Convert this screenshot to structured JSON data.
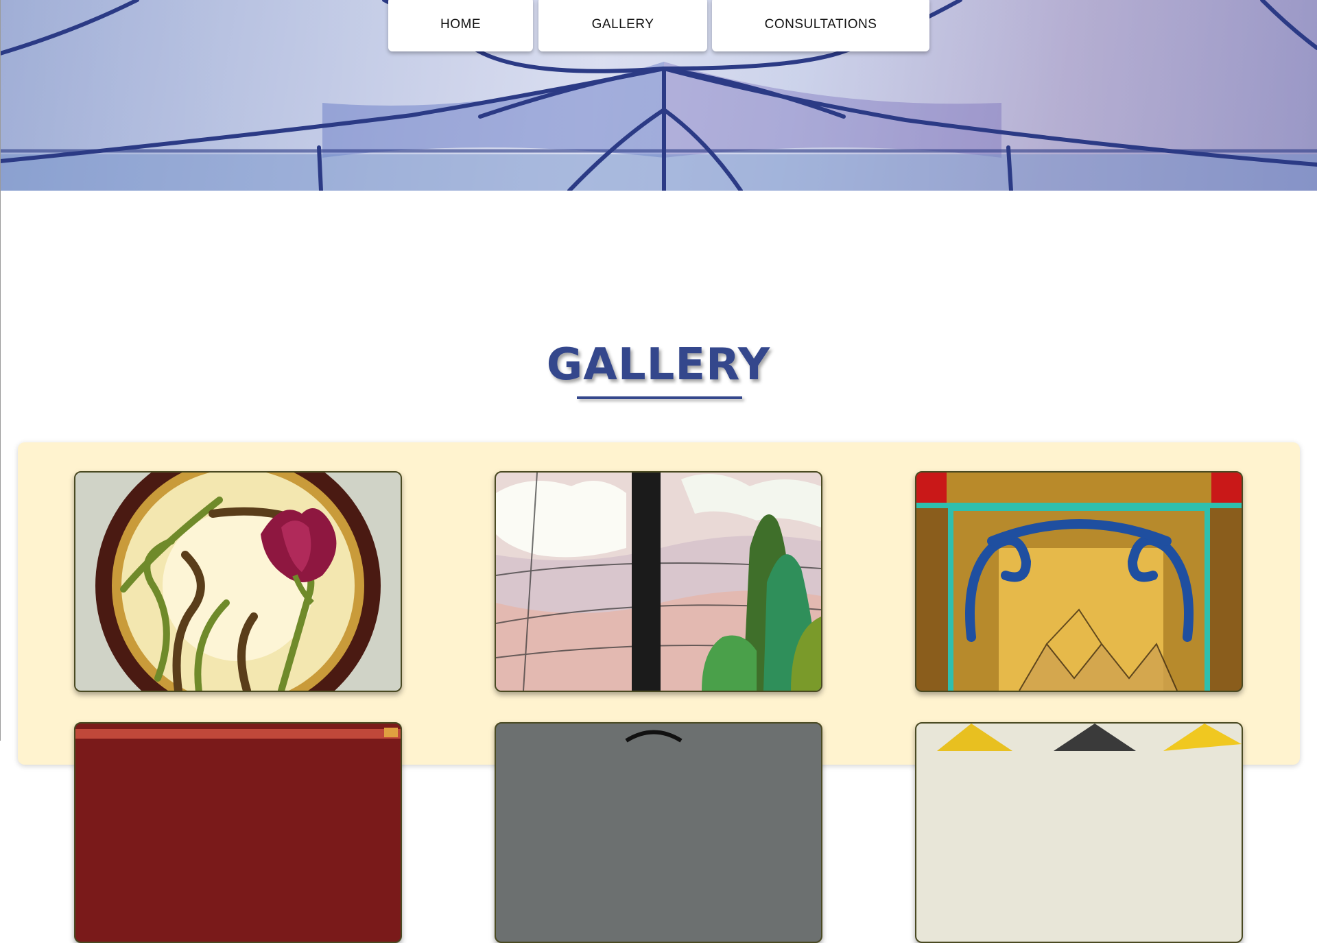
{
  "nav": {
    "items": [
      {
        "label": "HOME"
      },
      {
        "label": "GALLERY"
      },
      {
        "label": "CONSULTATIONS"
      }
    ]
  },
  "main": {
    "title": "GALLERY"
  },
  "colors": {
    "title": "#34478c",
    "panel_background": "#fff3cf",
    "nav_background": "#ffffff",
    "lead_lines": "#2b3a85"
  },
  "gallery": {
    "items": [
      {
        "subject": "circular stained glass with magenta tulip"
      },
      {
        "subject": "stained glass landscape with clouds and trees"
      },
      {
        "subject": "amber stained glass window with blue scroll border"
      },
      {
        "subject": "red stained glass panel"
      },
      {
        "subject": "grey stained glass panel"
      },
      {
        "subject": "yellow stained glass panel"
      }
    ]
  }
}
